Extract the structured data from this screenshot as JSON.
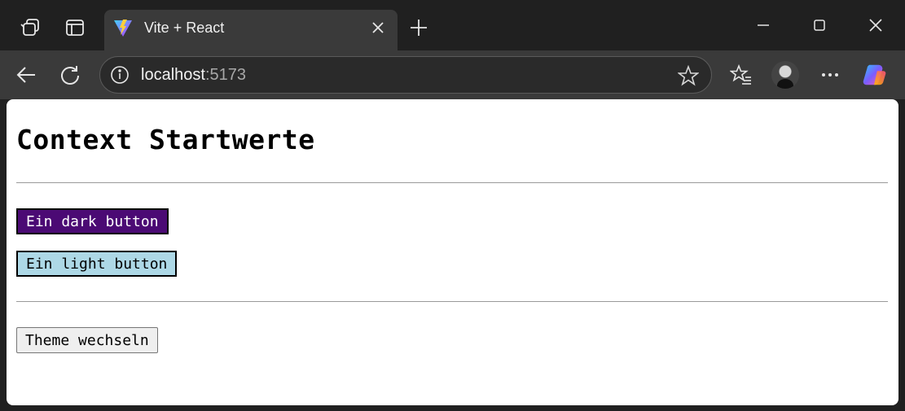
{
  "browser": {
    "tab": {
      "title": "Vite + React"
    },
    "address": {
      "host": "localhost",
      "port": ":5173"
    }
  },
  "page": {
    "title": "Context Startwerte",
    "dark_button": "Ein dark button",
    "light_button": "Ein light button",
    "toggle_button": "Theme wechseln"
  },
  "colors": {
    "dark_button_bg": "#4b0a74",
    "light_button_bg": "#add8e6",
    "chrome_bg": "#202020",
    "toolbar_bg": "#3a3a3a"
  },
  "icons": {
    "workspaces": "workspaces-icon",
    "tab_actions": "tab-actions-icon",
    "favicon": "vite-logo-icon",
    "close": "close-icon",
    "new_tab": "plus-icon",
    "minimize": "minimize-icon",
    "maximize": "maximize-icon",
    "window_close": "close-icon",
    "back": "back-arrow-icon",
    "refresh": "refresh-icon",
    "site_info": "info-icon",
    "favorite": "star-icon",
    "favorites": "favorites-icon",
    "profile": "avatar",
    "more": "more-icon",
    "copilot": "copilot-icon"
  }
}
